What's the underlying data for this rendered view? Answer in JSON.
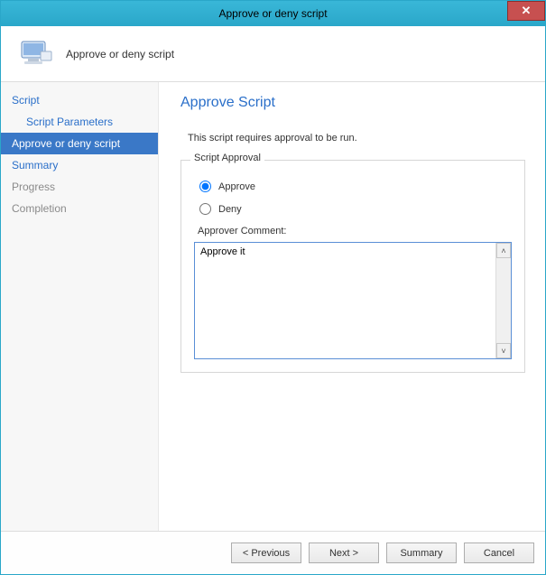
{
  "titlebar": {
    "title": "Approve or deny script",
    "close": "✕"
  },
  "header": {
    "label": "Approve or deny script"
  },
  "sidebar": {
    "items": [
      {
        "label": "Script",
        "indent": false,
        "selected": false,
        "disabled": false
      },
      {
        "label": "Script Parameters",
        "indent": true,
        "selected": false,
        "disabled": false
      },
      {
        "label": "Approve or deny script",
        "indent": false,
        "selected": true,
        "disabled": false
      },
      {
        "label": "Summary",
        "indent": false,
        "selected": false,
        "disabled": false
      },
      {
        "label": "Progress",
        "indent": false,
        "selected": false,
        "disabled": true
      },
      {
        "label": "Completion",
        "indent": false,
        "selected": false,
        "disabled": true
      }
    ]
  },
  "content": {
    "page_title": "Approve Script",
    "description": "This script requires approval to be run.",
    "group_legend": "Script Approval",
    "radio_approve": "Approve",
    "radio_deny": "Deny",
    "selected_radio": "approve",
    "comment_label": "Approver Comment:",
    "comment_value": "Approve it"
  },
  "footer": {
    "previous": "< Previous",
    "next": "Next >",
    "summary": "Summary",
    "cancel": "Cancel"
  }
}
